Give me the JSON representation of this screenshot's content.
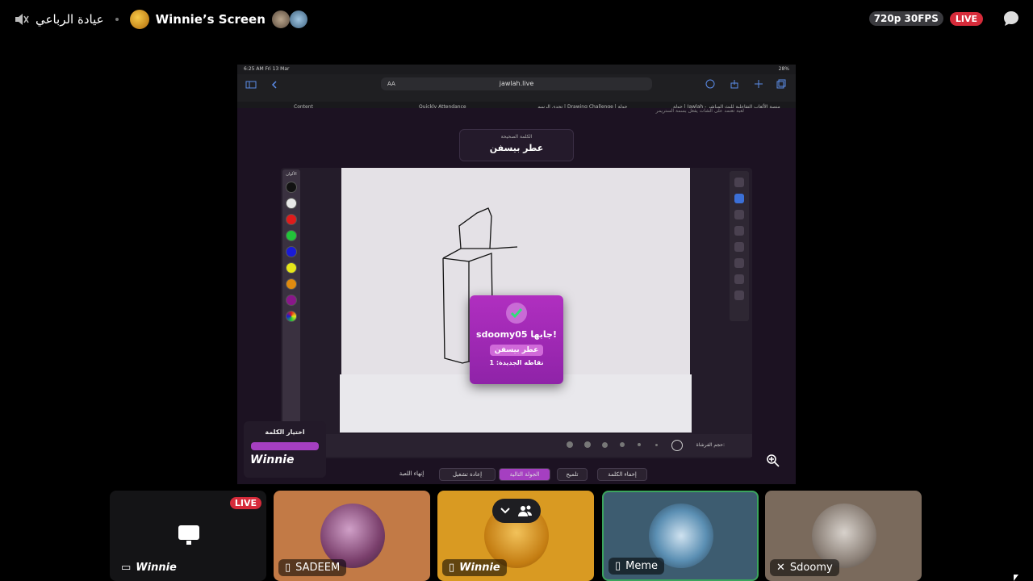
{
  "topbar": {
    "user_name": "عيادة الرباعي",
    "screen_title": "Winnie’s Screen",
    "quality": "720p 30FPS",
    "live_badge": "LIVE"
  },
  "stream": {
    "ios_time": "6:25 AM  Fri 13 Mar",
    "ios_battery": "28%",
    "url": "jawlah.live",
    "url_aa": "AA",
    "tabs": [
      "Content",
      "Quickly Attendance",
      "تحدي الرسم | Drawing Challenge | جولة",
      "جولة | Jawlah - منصة الألعاب التفاعلية للبث المباشر"
    ],
    "subtitle": "لعبة تعتمد على الشات يفعل بسمة الستريمر",
    "word_caption": "الكلمة الصحيحة",
    "word": "عطر بيسفن",
    "palette_title": "الألوان",
    "palette_colors": [
      "#111111",
      "#e8e8e8",
      "#e01b1b",
      "#22c43a",
      "#1a1ad6",
      "#e6e61a",
      "#e08a10",
      "#8a168a"
    ],
    "brush_label": "حجم الفرشاة:",
    "popup": {
      "line1": "sdoomy05 جابها!",
      "word": "عطر بيسفن",
      "points": "نقاطه الجديدة: 1"
    },
    "controls": {
      "end_game": "إنهاء اللعبة",
      "restart": "إعادة تشغيل",
      "next_round": "الجولة التالية",
      "hint": "تلميح",
      "hide_word": "إخفاء الكلمة"
    },
    "word_pick": "اختيار الكلمة",
    "brand": "Winnie"
  },
  "tiles": [
    {
      "name": "Winnie",
      "live": "LIVE",
      "bg": "#141416"
    },
    {
      "name": "SADEEM",
      "bg": "#c27a46"
    },
    {
      "name": "Winnie",
      "bg": "#d99a22"
    },
    {
      "name": "Meme",
      "bg": "#3d5c70"
    },
    {
      "name": "Sdoomy",
      "bg": "#7a6a5c"
    }
  ]
}
